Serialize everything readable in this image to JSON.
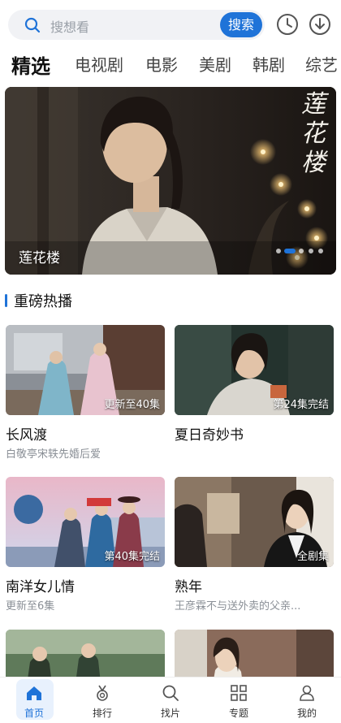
{
  "search": {
    "placeholder": "搜想看",
    "button_label": "搜索"
  },
  "top_icons": [
    "history-icon",
    "download-icon"
  ],
  "tabs": [
    "精选",
    "电视剧",
    "电影",
    "美剧",
    "韩剧",
    "综艺"
  ],
  "active_tab": "精选",
  "banner": {
    "caption": "莲花楼",
    "logo_text": "莲花楼",
    "slide_count": 5,
    "active_slide": 2
  },
  "section": {
    "title": "重磅热播"
  },
  "cards": [
    {
      "title": "长风渡",
      "subtitle": "白敬亭宋轶先婚后爱",
      "badge": "更新至40集"
    },
    {
      "title": "夏日奇妙书",
      "subtitle": "",
      "badge": "第24集完结"
    },
    {
      "title": "南洋女儿情",
      "subtitle": "更新至6集",
      "badge": "第40集完结"
    },
    {
      "title": "熟年",
      "subtitle": "王彦霖不与送外卖的父亲...",
      "badge": "全剧集"
    }
  ],
  "bottom_nav": [
    {
      "label": "首页",
      "icon": "home-icon",
      "active": true
    },
    {
      "label": "排行",
      "icon": "medal-icon",
      "active": false
    },
    {
      "label": "找片",
      "icon": "search-icon",
      "active": false
    },
    {
      "label": "专题",
      "icon": "grid-icon",
      "active": false
    },
    {
      "label": "我的",
      "icon": "user-icon",
      "active": false
    }
  ],
  "colors": {
    "accent": "#1f73d8",
    "search_bg": "#f1f2f5",
    "muted_text": "#8a8f96",
    "nav_active_bg": "#e8f1fd"
  }
}
